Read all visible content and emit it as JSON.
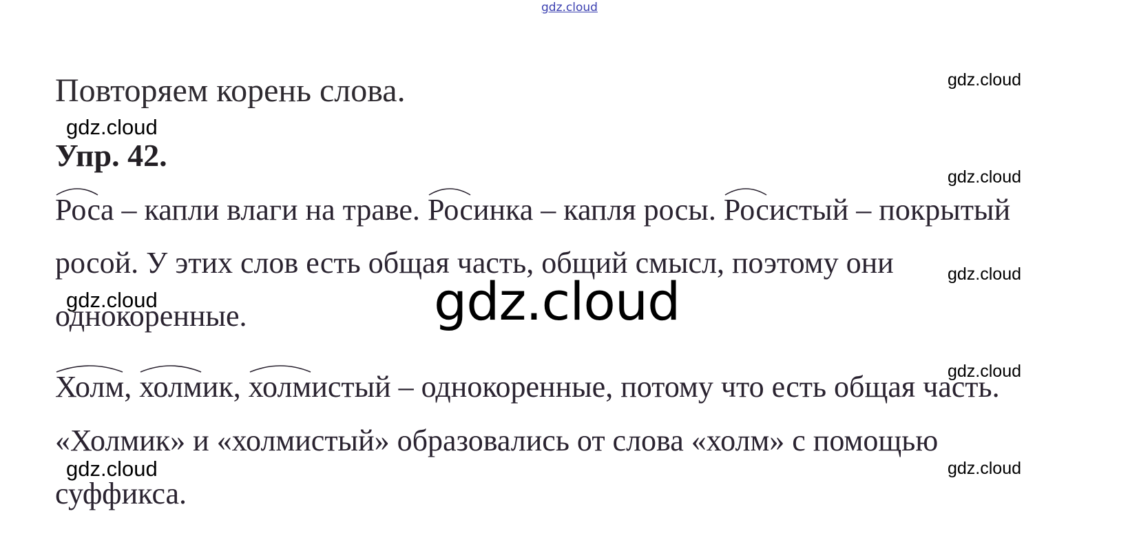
{
  "watermarks": {
    "top": "gdz.cloud",
    "center": "gdz.cloud",
    "right": [
      "gdz.cloud",
      "gdz.cloud",
      "gdz.cloud",
      "gdz.cloud",
      "gdz.cloud"
    ],
    "left": [
      "gdz.cloud",
      "gdz.cloud",
      "gdz.cloud"
    ]
  },
  "title": "Повторяем корень слова.",
  "exercise": "Упр. 42.",
  "para1": {
    "w1_root": "Рос",
    "w1_rest": "а – капли влаги на траве. ",
    "w2_root": "Рос",
    "w2_rest": "инка – капля росы. ",
    "w3_root": "Рос",
    "w3_rest": "истый – покрытый",
    "line2": "росой. У этих слов есть общая часть, общий смысл, поэтому они",
    "line3": "однокоренные."
  },
  "para2": {
    "w1_root": "Холм",
    "sep1": ", ",
    "w2_root": "холм",
    "w2_rest": "ик, ",
    "w3_root": "холм",
    "w3_rest": "истый – однокоренные, потому что есть общая часть."
  },
  "para3": {
    "line1": "«Холмик» и «холмистый» образовались от слова «холм» с помощью",
    "line2": "суффикса."
  }
}
